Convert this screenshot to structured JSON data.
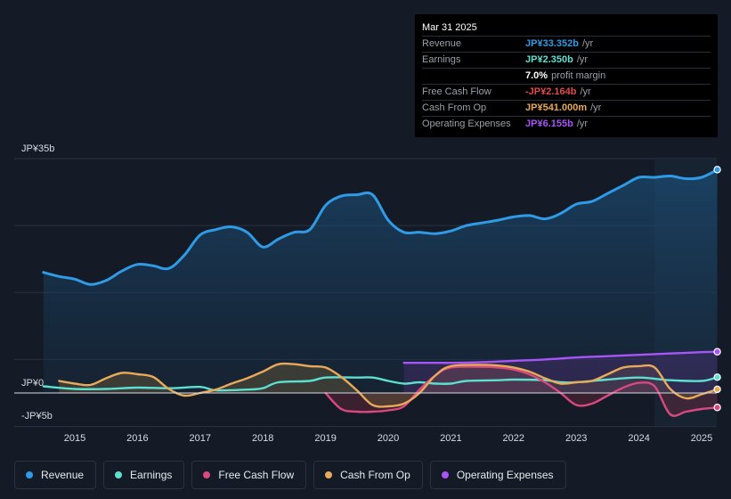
{
  "tooltip": {
    "date": "Mar 31 2025",
    "rows": [
      {
        "label": "Revenue",
        "value": "JP¥33.352b",
        "unit": "/yr",
        "color": "#2f9ae6"
      },
      {
        "label": "Earnings",
        "value": "JP¥2.350b",
        "unit": "/yr",
        "color": "#5ee0d0"
      },
      {
        "label": "",
        "value": "7.0%",
        "unit": "profit margin",
        "color": "#ffffff"
      },
      {
        "label": "Free Cash Flow",
        "value": "-JP¥2.164b",
        "unit": "/yr",
        "color": "#e04a4a"
      },
      {
        "label": "Cash From Op",
        "value": "JP¥541.000m",
        "unit": "/yr",
        "color": "#e8a95a"
      },
      {
        "label": "Operating Expenses",
        "value": "JP¥6.155b",
        "unit": "/yr",
        "color": "#a855f7"
      }
    ]
  },
  "legend": [
    {
      "label": "Revenue",
      "color": "#2f9ae6"
    },
    {
      "label": "Earnings",
      "color": "#5ee0d0"
    },
    {
      "label": "Free Cash Flow",
      "color": "#d9487e"
    },
    {
      "label": "Cash From Op",
      "color": "#e8a95a"
    },
    {
      "label": "Operating Expenses",
      "color": "#a855f7"
    }
  ],
  "chart_data": {
    "type": "line",
    "y_axis_labels": [
      "JP¥35b",
      "JP¥0",
      "-JP¥5b"
    ],
    "ylim": [
      -5,
      35
    ],
    "xlim": [
      2014.5,
      2025.25
    ],
    "x_ticks": [
      2015,
      2016,
      2017,
      2018,
      2019,
      2020,
      2021,
      2022,
      2023,
      2024,
      2025
    ],
    "x_tick_labels": [
      "2015",
      "2016",
      "2017",
      "2018",
      "2019",
      "2020",
      "2021",
      "2022",
      "2023",
      "2024",
      "2025"
    ],
    "highlight_from": 2024.25,
    "series": [
      {
        "name": "Revenue",
        "color": "#2f9ae6",
        "fill": true,
        "points": [
          [
            2014.5,
            18.0
          ],
          [
            2014.75,
            17.4
          ],
          [
            2015.0,
            17.0
          ],
          [
            2015.25,
            16.2
          ],
          [
            2015.5,
            16.8
          ],
          [
            2015.75,
            18.2
          ],
          [
            2016.0,
            19.2
          ],
          [
            2016.25,
            19.0
          ],
          [
            2016.5,
            18.6
          ],
          [
            2016.75,
            20.6
          ],
          [
            2017.0,
            23.6
          ],
          [
            2017.25,
            24.4
          ],
          [
            2017.5,
            24.8
          ],
          [
            2017.75,
            24.0
          ],
          [
            2018.0,
            21.8
          ],
          [
            2018.25,
            23.0
          ],
          [
            2018.5,
            24.0
          ],
          [
            2018.75,
            24.4
          ],
          [
            2019.0,
            28.0
          ],
          [
            2019.25,
            29.4
          ],
          [
            2019.5,
            29.6
          ],
          [
            2019.75,
            29.6
          ],
          [
            2020.0,
            25.8
          ],
          [
            2020.25,
            24.0
          ],
          [
            2020.5,
            24.0
          ],
          [
            2020.75,
            23.8
          ],
          [
            2021.0,
            24.2
          ],
          [
            2021.25,
            25.0
          ],
          [
            2021.5,
            25.4
          ],
          [
            2021.75,
            25.8
          ],
          [
            2022.0,
            26.3
          ],
          [
            2022.25,
            26.5
          ],
          [
            2022.5,
            26.0
          ],
          [
            2022.75,
            26.8
          ],
          [
            2023.0,
            28.2
          ],
          [
            2023.25,
            28.6
          ],
          [
            2023.5,
            29.8
          ],
          [
            2023.75,
            31.0
          ],
          [
            2024.0,
            32.2
          ],
          [
            2024.25,
            32.2
          ],
          [
            2024.5,
            32.4
          ],
          [
            2024.75,
            32.0
          ],
          [
            2025.0,
            32.2
          ],
          [
            2025.25,
            33.352
          ]
        ]
      },
      {
        "name": "Earnings",
        "color": "#5ee0d0",
        "fill": false,
        "points": [
          [
            2014.5,
            1.0
          ],
          [
            2015.0,
            0.6
          ],
          [
            2015.5,
            0.6
          ],
          [
            2016.0,
            0.8
          ],
          [
            2016.5,
            0.7
          ],
          [
            2017.0,
            0.9
          ],
          [
            2017.25,
            0.4
          ],
          [
            2017.75,
            0.5
          ],
          [
            2018.0,
            0.7
          ],
          [
            2018.25,
            1.6
          ],
          [
            2018.75,
            1.8
          ],
          [
            2019.0,
            2.3
          ],
          [
            2019.5,
            2.3
          ],
          [
            2019.75,
            2.3
          ],
          [
            2020.0,
            1.8
          ],
          [
            2020.25,
            1.4
          ],
          [
            2020.5,
            1.6
          ],
          [
            2020.75,
            1.4
          ],
          [
            2021.0,
            1.4
          ],
          [
            2021.25,
            1.8
          ],
          [
            2021.75,
            1.9
          ],
          [
            2022.0,
            2.0
          ],
          [
            2022.5,
            1.9
          ],
          [
            2022.75,
            1.6
          ],
          [
            2023.0,
            1.6
          ],
          [
            2023.5,
            2.0
          ],
          [
            2024.0,
            2.3
          ],
          [
            2024.5,
            1.9
          ],
          [
            2025.0,
            1.8
          ],
          [
            2025.25,
            2.35
          ]
        ]
      },
      {
        "name": "Free Cash Flow",
        "color": "#d9487e",
        "fill": false,
        "points": [
          [
            2019.0,
            0.0
          ],
          [
            2019.25,
            -2.4
          ],
          [
            2019.5,
            -2.8
          ],
          [
            2019.75,
            -2.8
          ],
          [
            2020.0,
            -2.6
          ],
          [
            2020.25,
            -2.0
          ],
          [
            2020.5,
            0.5
          ],
          [
            2020.75,
            2.6
          ],
          [
            2021.0,
            3.8
          ],
          [
            2021.5,
            3.9
          ],
          [
            2021.75,
            3.8
          ],
          [
            2022.0,
            3.5
          ],
          [
            2022.25,
            2.8
          ],
          [
            2022.5,
            1.6
          ],
          [
            2022.75,
            0.0
          ],
          [
            2023.0,
            -1.8
          ],
          [
            2023.25,
            -1.6
          ],
          [
            2023.5,
            -0.4
          ],
          [
            2023.75,
            0.8
          ],
          [
            2024.0,
            1.5
          ],
          [
            2024.25,
            1.0
          ],
          [
            2024.5,
            -3.2
          ],
          [
            2024.75,
            -2.8
          ],
          [
            2025.0,
            -2.4
          ],
          [
            2025.25,
            -2.164
          ]
        ]
      },
      {
        "name": "Cash From Op",
        "color": "#e8a95a",
        "fill": true,
        "points": [
          [
            2014.75,
            1.8
          ],
          [
            2015.0,
            1.4
          ],
          [
            2015.25,
            1.2
          ],
          [
            2015.5,
            2.2
          ],
          [
            2015.75,
            3.0
          ],
          [
            2016.0,
            2.8
          ],
          [
            2016.25,
            2.4
          ],
          [
            2016.5,
            0.6
          ],
          [
            2016.75,
            -0.4
          ],
          [
            2017.0,
            0.0
          ],
          [
            2017.25,
            0.5
          ],
          [
            2017.5,
            1.4
          ],
          [
            2017.75,
            2.2
          ],
          [
            2018.0,
            3.2
          ],
          [
            2018.25,
            4.3
          ],
          [
            2018.5,
            4.3
          ],
          [
            2018.75,
            4.0
          ],
          [
            2019.0,
            3.8
          ],
          [
            2019.25,
            2.4
          ],
          [
            2019.5,
            0.4
          ],
          [
            2019.75,
            -1.8
          ],
          [
            2020.0,
            -2.0
          ],
          [
            2020.25,
            -1.6
          ],
          [
            2020.5,
            0.0
          ],
          [
            2020.75,
            2.6
          ],
          [
            2021.0,
            4.0
          ],
          [
            2021.5,
            4.2
          ],
          [
            2021.75,
            4.1
          ],
          [
            2022.0,
            3.8
          ],
          [
            2022.25,
            3.2
          ],
          [
            2022.5,
            2.2
          ],
          [
            2022.75,
            1.4
          ],
          [
            2023.0,
            1.6
          ],
          [
            2023.25,
            1.8
          ],
          [
            2023.5,
            2.8
          ],
          [
            2023.75,
            3.8
          ],
          [
            2024.0,
            4.0
          ],
          [
            2024.25,
            3.8
          ],
          [
            2024.5,
            0.6
          ],
          [
            2024.75,
            -0.8
          ],
          [
            2025.0,
            -0.2
          ],
          [
            2025.25,
            0.541
          ]
        ]
      },
      {
        "name": "Operating Expenses",
        "color": "#a855f7",
        "fill": true,
        "points": [
          [
            2020.25,
            4.5
          ],
          [
            2020.75,
            4.5
          ],
          [
            2021.0,
            4.5
          ],
          [
            2021.5,
            4.6
          ],
          [
            2022.0,
            4.8
          ],
          [
            2022.5,
            5.0
          ],
          [
            2023.0,
            5.3
          ],
          [
            2023.5,
            5.5
          ],
          [
            2024.0,
            5.7
          ],
          [
            2024.5,
            5.9
          ],
          [
            2025.0,
            6.1
          ],
          [
            2025.25,
            6.155
          ]
        ]
      }
    ]
  }
}
